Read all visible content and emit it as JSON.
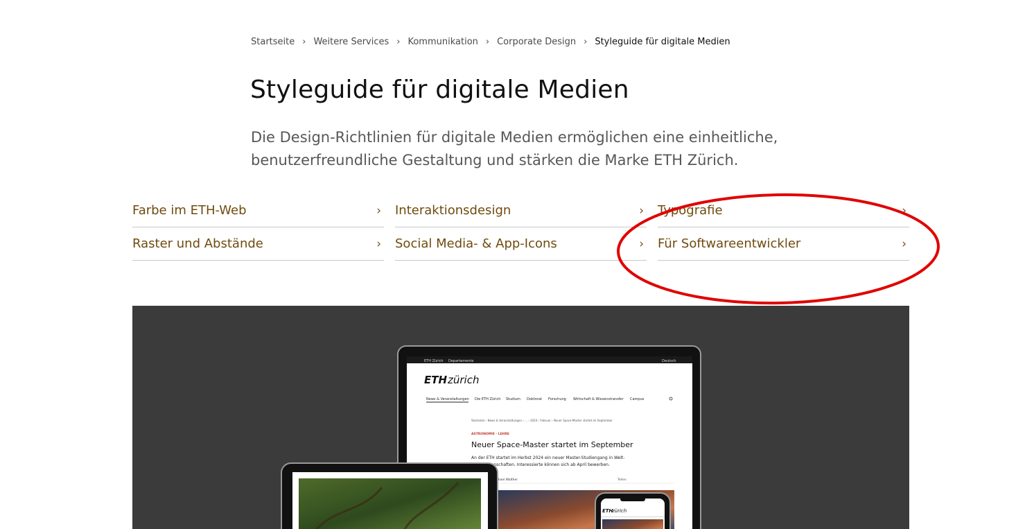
{
  "breadcrumb": {
    "items": [
      "Startseite",
      "Weitere Services",
      "Kommunikation",
      "Corporate Design"
    ],
    "current": "Styleguide für digitale Medien",
    "separator": "›"
  },
  "page": {
    "title": "Styleguide für digitale Medien",
    "lead": "Die Design-Richtlinien für digitale Medien ermöglichen eine einheitliche, benutzerfreundliche Gestaltung und stärken die Marke ETH Zürich."
  },
  "links": [
    {
      "label": "Farbe im ETH-Web"
    },
    {
      "label": "Interaktionsdesign"
    },
    {
      "label": "Typografie"
    },
    {
      "label": "Raster und Abstände"
    },
    {
      "label": "Social Media- & App-Icons"
    },
    {
      "label": "Für Softwareentwickler"
    }
  ],
  "colors": {
    "link": "#6f4b0e",
    "annotation": "#e00000",
    "hero_bg": "#3b3b3b"
  },
  "hero": {
    "mock_site": {
      "topbar_left": "ETH Zürich",
      "topbar_menu": "Departemente",
      "topbar_right": "Deutsch",
      "logo_bold": "ETH",
      "logo_light": "zürich",
      "nav": [
        "News & Veranstaltungen",
        "Die ETH Zürich",
        "Studium",
        "Doktorat",
        "Forschung",
        "Wirtschaft & Wissenstransfer",
        "Campus"
      ],
      "crumbs": "Startseite  ›  News & Veranstaltungen  ›  ...  ›  2024  ›  Februar  ›  Neuer Space-Master startet im September",
      "kicker": "ASTRONOMIE · LEHRE",
      "headline": "Neuer Space-Master startet im September",
      "teaser_1": "An der ETH startet im Herbst 2024 ein neuer Master-Studiengang in Welt-",
      "teaser_2": "raumwissenschaften. Interessierte können sich ab April bewerben.",
      "author": "Michael Walther",
      "share": "Teilen"
    },
    "phone_logo_bold": "ETH",
    "phone_logo_light": "zürich"
  }
}
